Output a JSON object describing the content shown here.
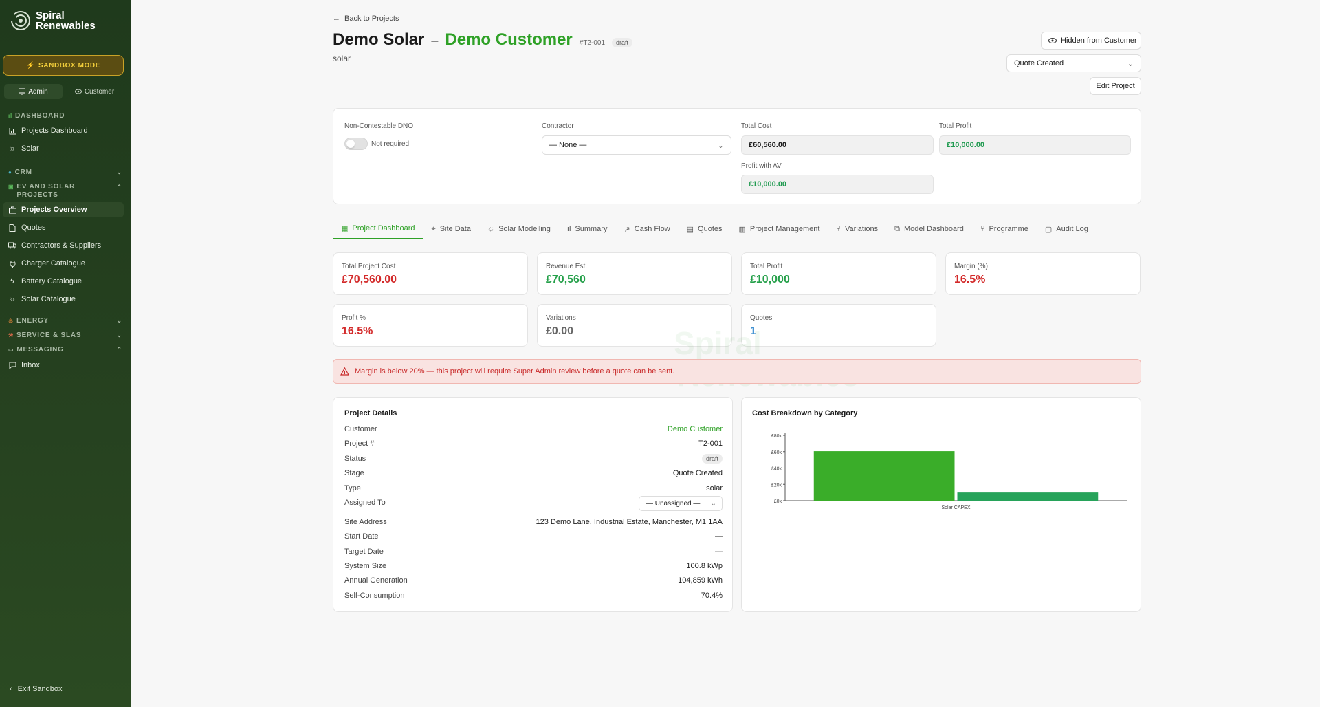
{
  "sidebar": {
    "brand_line1": "Spiral",
    "brand_line2": "Renewables",
    "sandbox_label": "SANDBOX MODE",
    "roles": [
      "Admin",
      "Customer"
    ],
    "sections": {
      "dashboard": "DASHBOARD",
      "crm": "CRM",
      "ev_solar": "EV AND SOLAR",
      "ev_solar_2": "PROJECTS",
      "energy": "ENERGY",
      "service": "SERVICE & SLAS",
      "messaging": "MESSAGING"
    },
    "items": {
      "projects_dashboard": "Projects Dashboard",
      "solar": "Solar",
      "projects_overview": "Projects Overview",
      "quotes": "Quotes",
      "contractors": "Contractors & Suppliers",
      "charger": "Charger Catalogue",
      "battery": "Battery Catalogue",
      "solar_catalogue": "Solar Catalogue",
      "inbox": "Inbox"
    },
    "exit_label": "Exit Sandbox"
  },
  "header": {
    "back_label": "Back to Projects",
    "project_name": "Demo Solar",
    "separator": "–",
    "customer": "Demo Customer",
    "project_number": "#T2-001",
    "status_badge": "draft",
    "type": "solar",
    "visibility_button": "Hidden from Customer",
    "stage_value": "Quote Created",
    "edit_button": "Edit Project"
  },
  "summary_card": {
    "dno_label": "Non-Contestable DNO",
    "dno_value": "Not required",
    "contractor_label": "Contractor",
    "contractor_value": "— None —",
    "total_cost_label": "Total Cost",
    "total_cost_value": "£60,560.00",
    "total_profit_label": "Total Profit",
    "total_profit_value": "£10,000.00",
    "profit_av_label": "Profit with AV",
    "profit_av_value": "£10,000.00"
  },
  "tabs": [
    "Project Dashboard",
    "Site Data",
    "Solar Modelling",
    "Summary",
    "Cash Flow",
    "Quotes",
    "Project Management",
    "Variations",
    "Model Dashboard",
    "Programme",
    "Audit Log"
  ],
  "metrics": [
    {
      "label": "Total Project Cost",
      "value": "£70,560.00"
    },
    {
      "label": "Revenue Est.",
      "value": "£70,560"
    },
    {
      "label": "Total Profit",
      "value": "£10,000"
    },
    {
      "label": "Margin (%)",
      "value": "16.5%"
    },
    {
      "label": "Profit %",
      "value": "16.5%"
    },
    {
      "label": "Variations",
      "value": "£0.00"
    },
    {
      "label": "Quotes",
      "value": "1"
    }
  ],
  "warning": "Margin is below 20% — this project will require Super Admin review before a quote can be sent.",
  "watermark": {
    "line1": "Spiral",
    "line2": "Renewables"
  },
  "details": {
    "title": "Project Details",
    "rows": [
      {
        "k": "Customer",
        "v": "Demo Customer"
      },
      {
        "k": "Project #",
        "v": "T2-001"
      },
      {
        "k": "Status",
        "v": "draft"
      },
      {
        "k": "Stage",
        "v": "Quote Created"
      },
      {
        "k": "Type",
        "v": "solar"
      },
      {
        "k": "Assigned To",
        "v": "— Unassigned —"
      },
      {
        "k": "Site Address",
        "v": "123 Demo Lane, Industrial Estate, Manchester, M1 1AA"
      },
      {
        "k": "Start Date",
        "v": "—"
      },
      {
        "k": "Target Date",
        "v": "—"
      },
      {
        "k": "System Size",
        "v": "100.8 kWp"
      },
      {
        "k": "Annual Generation",
        "v": "104,859 kWh"
      },
      {
        "k": "Self-Consumption",
        "v": "70.4%"
      }
    ]
  },
  "chart_data": {
    "type": "bar",
    "title": "Cost Breakdown by Category",
    "categories": [
      "Solar CAPEX"
    ],
    "series": [
      {
        "values": [
          60560
        ],
        "color": "#3aad29"
      },
      {
        "values": [
          10000
        ],
        "color": "#27a35a"
      }
    ],
    "yticks": [
      "£0k",
      "£20k",
      "£40k",
      "£60k",
      "£80k"
    ],
    "ylim": [
      0,
      80000
    ]
  },
  "colors": {
    "brand_green": "#2fa127",
    "danger": "#d32a2a",
    "accent_blue": "#3d8fd1"
  }
}
